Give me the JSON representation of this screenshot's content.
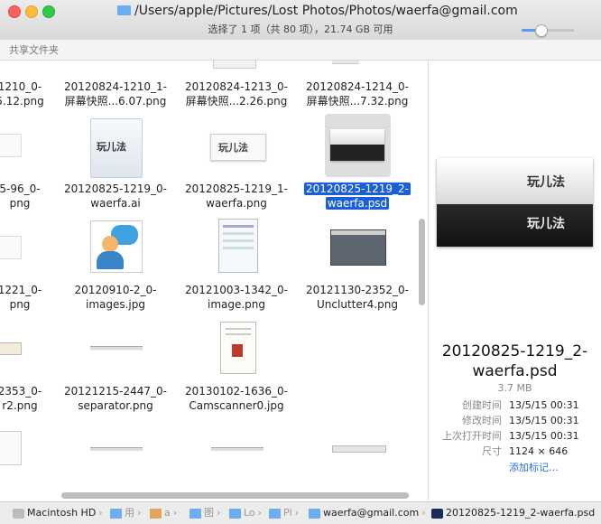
{
  "window": {
    "title": "/Users/apple/Pictures/Lost Photos/Photos/waerfa@gmail.com",
    "status": "选择了 1 项（共 80 项），21.74 GB 可用"
  },
  "sharebar": {
    "label": "共享文件夹"
  },
  "files": {
    "row0": [
      {
        "l1": "1210_0-",
        "l2": "5.12.png"
      },
      {
        "l1": "20120824-1210_1-",
        "l2": "屏幕快照...6.07.png"
      },
      {
        "l1": "20120824-1213_0-",
        "l2": "屏幕快照...2.26.png"
      },
      {
        "l1": "20120824-1214_0-",
        "l2": "屏幕快照...7.32.png"
      }
    ],
    "row1": [
      {
        "l1": "5-96_0-",
        "l2": "png"
      },
      {
        "l1": "20120825-1219_0-",
        "l2": "waerfa.ai"
      },
      {
        "l1": "20120825-1219_1-",
        "l2": "waerfa.png"
      },
      {
        "l1": "20120825-1219_2-",
        "l2": "waerfa.psd"
      }
    ],
    "row2": [
      {
        "l1": "1221_0-",
        "l2": "png"
      },
      {
        "l1": "20120910-2_0-",
        "l2": "images.jpg"
      },
      {
        "l1": "20121003-1342_0-",
        "l2": "image.png"
      },
      {
        "l1": "20121130-2352_0-",
        "l2": "Unclutter4.png"
      }
    ],
    "row3": [
      {
        "l1": "2353_0-",
        "l2": "r2.png"
      },
      {
        "l1": "20121215-2447_0-",
        "l2": "separator.png"
      },
      {
        "l1": "20130102-1636_0-",
        "l2": "Camscanner0.jpg"
      }
    ],
    "thumb_brand": "玩儿法"
  },
  "preview": {
    "name_line1": "20120825-1219_2-",
    "name_line2": "waerfa.psd",
    "size": "3.7 MB",
    "rows": [
      {
        "k": "创建时间",
        "v": "13/5/15 00:31"
      },
      {
        "k": "修改时间",
        "v": "13/5/15 00:31"
      },
      {
        "k": "上次打开时间",
        "v": "13/5/15 00:31"
      },
      {
        "k": "尺寸",
        "v": "1124 × 646"
      }
    ],
    "add_tags": "添加标记…"
  },
  "pathbar": [
    {
      "label": "Macintosh HD"
    },
    {
      "label": "用"
    },
    {
      "label": "a"
    },
    {
      "label": "图"
    },
    {
      "label": "Lo"
    },
    {
      "label": "Pl"
    },
    {
      "label": "waerfa@gmail.com"
    },
    {
      "label": "20120825-1219_2-waerfa.psd"
    }
  ]
}
